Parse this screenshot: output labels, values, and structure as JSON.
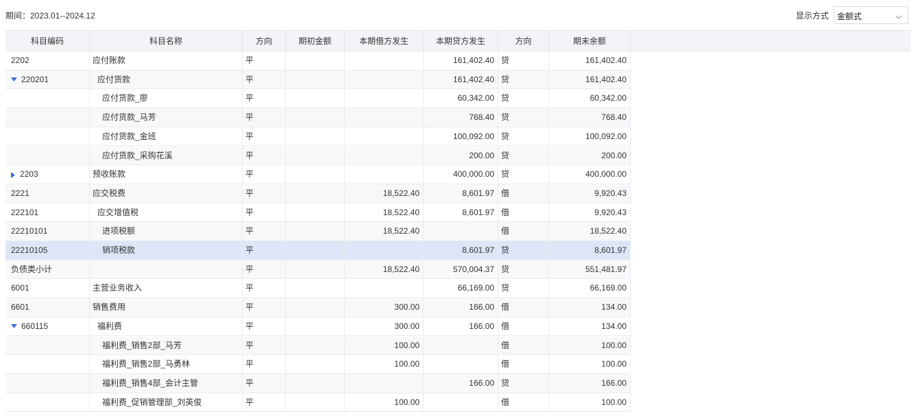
{
  "toolbar": {
    "period": "期间：2023.01--2024.12",
    "display_label": "显示方式",
    "display_value": "金额式"
  },
  "columns": [
    "科目编码",
    "科目名称",
    "方向",
    "期初金额",
    "本期借方发生",
    "本期贷方发生",
    "方向",
    "期末余额"
  ],
  "rows": [
    {
      "code": "2202",
      "name": "应付账款",
      "dir": "平",
      "opening": "",
      "debit": "",
      "credit": "161,402.40",
      "dir2": "贷",
      "ending": "161,402.40",
      "indent": 0,
      "toggle": ""
    },
    {
      "code": "220201",
      "name": "应付货款",
      "dir": "平",
      "opening": "",
      "debit": "",
      "credit": "161,402.40",
      "dir2": "贷",
      "ending": "161,402.40",
      "indent": 1,
      "toggle": "down"
    },
    {
      "code": "",
      "name": "应付货款_廖",
      "dir": "平",
      "opening": "",
      "debit": "",
      "credit": "60,342.00",
      "dir2": "贷",
      "ending": "60,342.00",
      "indent": 2,
      "toggle": ""
    },
    {
      "code": "",
      "name": "应付货款_马芳",
      "dir": "平",
      "opening": "",
      "debit": "",
      "credit": "768.40",
      "dir2": "贷",
      "ending": "768.40",
      "indent": 2,
      "toggle": ""
    },
    {
      "code": "",
      "name": "应付货款_金班",
      "dir": "平",
      "opening": "",
      "debit": "",
      "credit": "100,092.00",
      "dir2": "贷",
      "ending": "100,092.00",
      "indent": 2,
      "toggle": ""
    },
    {
      "code": "",
      "name": "应付货款_采购花溪",
      "dir": "平",
      "opening": "",
      "debit": "",
      "credit": "200.00",
      "dir2": "贷",
      "ending": "200.00",
      "indent": 2,
      "toggle": ""
    },
    {
      "code": "2203",
      "name": "预收账款",
      "dir": "平",
      "opening": "",
      "debit": "",
      "credit": "400,000.00",
      "dir2": "贷",
      "ending": "400,000.00",
      "indent": 0,
      "toggle": "right"
    },
    {
      "code": "2221",
      "name": "应交税费",
      "dir": "平",
      "opening": "",
      "debit": "18,522.40",
      "credit": "8,601.97",
      "dir2": "借",
      "ending": "9,920.43",
      "indent": 0,
      "toggle": ""
    },
    {
      "code": "222101",
      "name": "应交增值税",
      "dir": "平",
      "opening": "",
      "debit": "18,522.40",
      "credit": "8,601.97",
      "dir2": "借",
      "ending": "9,920.43",
      "indent": 1,
      "toggle": ""
    },
    {
      "code": "22210101",
      "name": "进项税额",
      "dir": "平",
      "opening": "",
      "debit": "18,522.40",
      "credit": "",
      "dir2": "借",
      "ending": "18,522.40",
      "indent": 2,
      "toggle": ""
    },
    {
      "code": "22210105",
      "name": "销项税款",
      "dir": "平",
      "opening": "",
      "debit": "",
      "credit": "8,601.97",
      "dir2": "贷",
      "ending": "8,601.97",
      "indent": 2,
      "toggle": "",
      "selected": true
    },
    {
      "code": "负债类小计",
      "name": "",
      "dir": "平",
      "opening": "",
      "debit": "18,522.40",
      "credit": "570,004.37",
      "dir2": "贷",
      "ending": "551,481.97",
      "indent": 0,
      "toggle": ""
    },
    {
      "code": "6001",
      "name": "主营业务收入",
      "dir": "平",
      "opening": "",
      "debit": "",
      "credit": "66,169.00",
      "dir2": "贷",
      "ending": "66,169.00",
      "indent": 0,
      "toggle": ""
    },
    {
      "code": "6601",
      "name": "销售费用",
      "dir": "平",
      "opening": "",
      "debit": "300.00",
      "credit": "166.00",
      "dir2": "借",
      "ending": "134.00",
      "indent": 0,
      "toggle": ""
    },
    {
      "code": "660115",
      "name": "福利费",
      "dir": "平",
      "opening": "",
      "debit": "300.00",
      "credit": "166.00",
      "dir2": "借",
      "ending": "134.00",
      "indent": 1,
      "toggle": "down"
    },
    {
      "code": "",
      "name": "福利费_销售2部_马芳",
      "dir": "平",
      "opening": "",
      "debit": "100.00",
      "credit": "",
      "dir2": "借",
      "ending": "100.00",
      "indent": 2,
      "toggle": ""
    },
    {
      "code": "",
      "name": "福利费_销售2部_马勇林",
      "dir": "平",
      "opening": "",
      "debit": "100.00",
      "credit": "",
      "dir2": "借",
      "ending": "100.00",
      "indent": 2,
      "toggle": ""
    },
    {
      "code": "",
      "name": "福利费_销售4部_会计主管",
      "dir": "平",
      "opening": "",
      "debit": "",
      "credit": "166.00",
      "dir2": "贷",
      "ending": "166.00",
      "indent": 2,
      "toggle": ""
    },
    {
      "code": "",
      "name": "福利费_促销管理部_刘英俊",
      "dir": "平",
      "opening": "",
      "debit": "100.00",
      "credit": "",
      "dir2": "借",
      "ending": "100.00",
      "indent": 2,
      "toggle": ""
    }
  ],
  "colors": {
    "header_bg": "#f2f4f7",
    "selected_row": "#dde6f7",
    "toggle_icon": "#3b6fd8"
  }
}
